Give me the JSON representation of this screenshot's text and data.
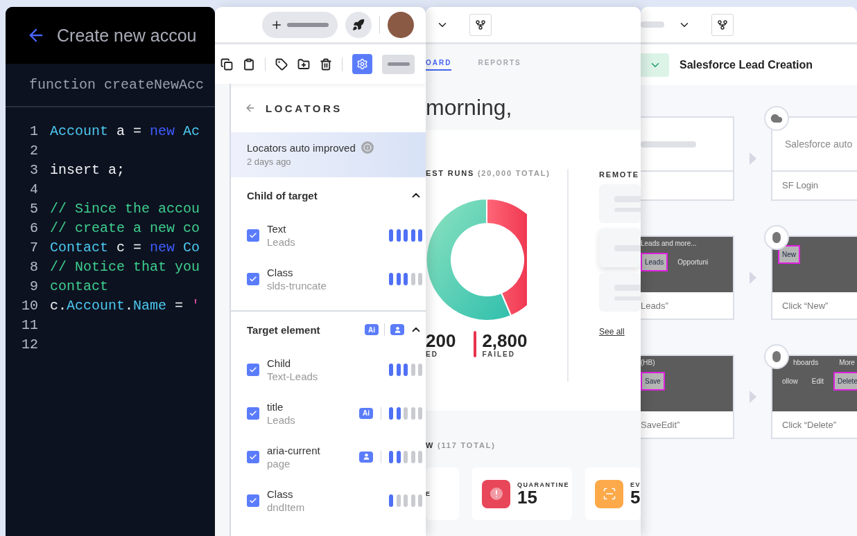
{
  "code_window": {
    "title": "Create new accou",
    "function": "function createNewAcc",
    "lines": [
      {
        "number": "1",
        "tokens": [
          {
            "text": "Account",
            "kind": "type"
          },
          {
            "text": " a = ",
            "kind": "plain"
          },
          {
            "text": "new",
            "kind": "keyword"
          },
          {
            "text": " Ac",
            "kind": "type"
          }
        ]
      },
      {
        "number": "2"
      },
      {
        "number": "3",
        "tokens": [
          {
            "text": "insert a;",
            "kind": "plain"
          }
        ]
      },
      {
        "number": "4"
      },
      {
        "number": "5",
        "tokens": [
          {
            "text": "// Since the accou",
            "kind": "comment"
          }
        ]
      },
      {
        "number": "6",
        "tokens": [
          {
            "text": "// create a new co",
            "kind": "comment"
          }
        ]
      },
      {
        "number": "7",
        "tokens": [
          {
            "text": "Contact",
            "kind": "type"
          },
          {
            "text": " c = ",
            "kind": "plain"
          },
          {
            "text": "new",
            "kind": "keyword"
          },
          {
            "text": " Co",
            "kind": "type"
          }
        ]
      },
      {
        "number": "8",
        "tokens": [
          {
            "text": "// Notice that you",
            "kind": "comment"
          }
        ]
      },
      {
        "number": "9",
        "tokens": [
          {
            "text": "contact",
            "kind": "comment"
          }
        ]
      },
      {
        "number": "10",
        "tokens": [
          {
            "text": "c.",
            "kind": "plain"
          },
          {
            "text": "Account",
            "kind": "type"
          },
          {
            "text": ".",
            "kind": "plain"
          },
          {
            "text": "Name",
            "kind": "type"
          },
          {
            "text": " = ",
            "kind": "plain"
          },
          {
            "text": "'",
            "kind": "string"
          }
        ]
      },
      {
        "number": "11"
      },
      {
        "number": "12"
      }
    ]
  },
  "locators_panel": {
    "title": "LOCATORS",
    "banner": {
      "title": "Locators auto improved",
      "time": "2 days ago"
    },
    "sections": [
      {
        "title": "Child of target",
        "expanded": true,
        "rows": [
          {
            "name": "Text",
            "value": "Leads",
            "checked": true,
            "level": 1.0
          },
          {
            "name": "Class",
            "value": "slds-truncate",
            "checked": true,
            "level": 0.6
          }
        ]
      },
      {
        "title": "Target element",
        "expanded": true,
        "badges": [
          {
            "kind": "ai",
            "label": "Ai"
          },
          {
            "kind": "user"
          }
        ],
        "rows": [
          {
            "name": "Child",
            "value": "Text-Leads",
            "checked": true,
            "level": 0.6
          },
          {
            "name": "title",
            "value": "Leads",
            "checked": true,
            "level": 0.4,
            "badge": {
              "kind": "ai",
              "label": "Ai"
            }
          },
          {
            "name": "aria-current",
            "value": "page",
            "checked": true,
            "level": 0.4,
            "badge": {
              "kind": "user"
            }
          },
          {
            "name": "Class",
            "value": "dndItem",
            "checked": true,
            "level": 0.2
          }
        ]
      }
    ]
  },
  "dashboard": {
    "tabs": [
      {
        "label": "OARD",
        "selected": true
      },
      {
        "label": "REPORTS",
        "selected": false
      }
    ],
    "greeting": "morning,",
    "runs_title": "EST RUNS",
    "runs_total": "(20,000 TOTAL)",
    "stats": [
      {
        "value": "200",
        "label": "ED"
      },
      {
        "value": "2,800",
        "label": "FAILED"
      }
    ],
    "remote_title": "REMOTE",
    "see_all": "See all",
    "overview_title": "W",
    "overview_total": "(117 TOTAL)",
    "cards": [
      {
        "kind": "plain",
        "label": "E"
      },
      {
        "kind": "quarantine",
        "label": "QUARANTINE",
        "value": "15"
      },
      {
        "kind": "evaluate",
        "label": "EV",
        "value": "5"
      }
    ]
  },
  "flow_editor": {
    "title": "Salesforce Lead Creation",
    "steps": [
      {
        "kind": "skeleton"
      },
      {
        "kind": "login",
        "description": "Salesforce auto",
        "label": "SF Login"
      },
      {
        "kind": "capture",
        "caption": [
          "Leads and more..."
        ],
        "buttons": [
          {
            "label": "Leads",
            "highlighted": true
          },
          {
            "label": "Opportuni",
            "highlighted": false
          }
        ],
        "label": "Leads”"
      },
      {
        "kind": "click",
        "buttons": [
          {
            "label": "New",
            "highlighted": true
          }
        ],
        "label": "Click “New”"
      },
      {
        "kind": "capture",
        "caption": [
          "(HB)"
        ],
        "buttons": [
          {
            "label": "Save",
            "highlighted": true
          }
        ],
        "label": "SaveEdit”"
      },
      {
        "kind": "click",
        "caption": [
          "hboards",
          "More"
        ],
        "buttons": [
          {
            "label": "ollow",
            "highlighted": false
          },
          {
            "label": "Edit",
            "highlighted": false
          },
          {
            "label": "Delete",
            "highlighted": true
          }
        ],
        "label": "Click “Delete”"
      }
    ]
  }
}
